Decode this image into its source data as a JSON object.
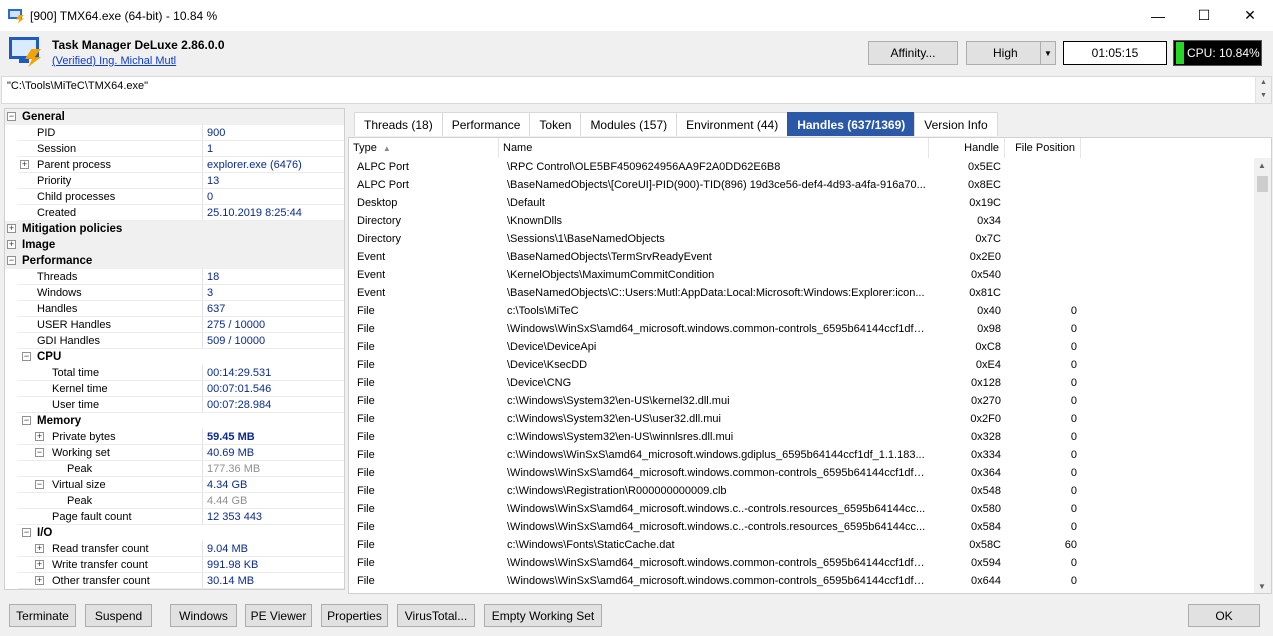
{
  "window": {
    "title": "[900] TMX64.exe (64-bit) - 10.84 %",
    "minimize": "—",
    "maximize": "☐",
    "close": "✕"
  },
  "header": {
    "app_name": "Task Manager DeLuxe 2.86.0.0",
    "publisher": "(Verified) Ing. Michal Mutl",
    "affinity_label": "Affinity...",
    "priority_value": "High",
    "priority_arrow": "▼",
    "elapsed_time": "01:05:15",
    "cpu_label": "CPU: 10.84%"
  },
  "path": "\"C:\\Tools\\MiTeC\\TMX64.exe\"",
  "path_scroll": {
    "up": "▲",
    "down": "▼"
  },
  "properties": {
    "general": {
      "label": "General",
      "exp": "−",
      "pid_label": "PID",
      "pid": "900",
      "session_label": "Session",
      "session": "1",
      "parent_exp": "+",
      "parent_label": "Parent process",
      "parent": "explorer.exe (6476)",
      "priority_label": "Priority",
      "priority": "13",
      "children_label": "Child processes",
      "children": "0",
      "created_label": "Created",
      "created": "25.10.2019 8:25:44"
    },
    "mitigation": {
      "label": "Mitigation policies",
      "exp": "+"
    },
    "image": {
      "label": "Image",
      "exp": "+"
    },
    "performance": {
      "label": "Performance",
      "exp": "−",
      "threads_label": "Threads",
      "threads": "18",
      "windows_label": "Windows",
      "windows": "3",
      "handles_label": "Handles",
      "handles": "637",
      "user_handles_label": "USER Handles",
      "user_handles": "275 / 10000",
      "gdi_handles_label": "GDI Handles",
      "gdi_handles": "509 / 10000",
      "cpu": {
        "label": "CPU",
        "exp": "−",
        "total_label": "Total time",
        "total": "00:14:29.531",
        "kernel_label": "Kernel time",
        "kernel": "00:07:01.546",
        "user_label": "User time",
        "user": "00:07:28.984"
      },
      "memory": {
        "label": "Memory",
        "exp": "−",
        "private_exp": "+",
        "private_label": "Private bytes",
        "private": "59.45 MB",
        "ws_exp": "−",
        "ws_label": "Working set",
        "ws": "40.69 MB",
        "ws_peak_label": "Peak",
        "ws_peak": "177.36 MB",
        "vs_exp": "−",
        "vs_label": "Virtual size",
        "vs": "4.34 GB",
        "vs_peak_label": "Peak",
        "vs_peak": "4.44 GB",
        "pf_label": "Page fault count",
        "pf": "12 353 443"
      },
      "io": {
        "label": "I/O",
        "exp": "−",
        "read_exp": "+",
        "read_label": "Read transfer count",
        "read": "9.04 MB",
        "write_exp": "+",
        "write_label": "Write transfer count",
        "write": "991.98 KB",
        "other_exp": "+",
        "other_label": "Other transfer count",
        "other": "30.14 MB"
      }
    }
  },
  "tabs": [
    {
      "label": "Threads (18)"
    },
    {
      "label": "Performance"
    },
    {
      "label": "Token"
    },
    {
      "label": "Modules (157)"
    },
    {
      "label": "Environment (44)"
    },
    {
      "label": "Handles (637/1369)"
    },
    {
      "label": "Version Info"
    }
  ],
  "handles_table": {
    "columns": {
      "type": "Type",
      "name": "Name",
      "handle": "Handle",
      "file_position": "File Position",
      "sort_glyph": "▲"
    },
    "rows": [
      {
        "type": "ALPC Port",
        "name": "\\RPC Control\\OLE5BF4509624956AA9F2A0DD62E6B8",
        "handle": "0x5EC",
        "fpos": ""
      },
      {
        "type": "ALPC Port",
        "name": "\\BaseNamedObjects\\[CoreUI]-PID(900)-TID(896) 19d3ce56-def4-4d93-a4fa-916a70...",
        "handle": "0x8EC",
        "fpos": ""
      },
      {
        "type": "Desktop",
        "name": "\\Default",
        "handle": "0x19C",
        "fpos": ""
      },
      {
        "type": "Directory",
        "name": "\\KnownDlls",
        "handle": "0x34",
        "fpos": ""
      },
      {
        "type": "Directory",
        "name": "\\Sessions\\1\\BaseNamedObjects",
        "handle": "0x7C",
        "fpos": ""
      },
      {
        "type": "Event",
        "name": "\\BaseNamedObjects\\TermSrvReadyEvent",
        "handle": "0x2E0",
        "fpos": ""
      },
      {
        "type": "Event",
        "name": "\\KernelObjects\\MaximumCommitCondition",
        "handle": "0x540",
        "fpos": ""
      },
      {
        "type": "Event",
        "name": "\\BaseNamedObjects\\C::Users:Mutl:AppData:Local:Microsoft:Windows:Explorer:icon...",
        "handle": "0x81C",
        "fpos": ""
      },
      {
        "type": "File",
        "name": "c:\\Tools\\MiTeC",
        "handle": "0x40",
        "fpos": "0"
      },
      {
        "type": "File",
        "name": "\\Windows\\WinSxS\\amd64_microsoft.windows.common-controls_6595b64144ccf1df_...",
        "handle": "0x98",
        "fpos": "0"
      },
      {
        "type": "File",
        "name": "\\Device\\DeviceApi",
        "handle": "0xC8",
        "fpos": "0"
      },
      {
        "type": "File",
        "name": "\\Device\\KsecDD",
        "handle": "0xE4",
        "fpos": "0"
      },
      {
        "type": "File",
        "name": "\\Device\\CNG",
        "handle": "0x128",
        "fpos": "0"
      },
      {
        "type": "File",
        "name": "c:\\Windows\\System32\\en-US\\kernel32.dll.mui",
        "handle": "0x270",
        "fpos": "0"
      },
      {
        "type": "File",
        "name": "c:\\Windows\\System32\\en-US\\user32.dll.mui",
        "handle": "0x2F0",
        "fpos": "0"
      },
      {
        "type": "File",
        "name": "c:\\Windows\\System32\\en-US\\winnlsres.dll.mui",
        "handle": "0x328",
        "fpos": "0"
      },
      {
        "type": "File",
        "name": "c:\\Windows\\WinSxS\\amd64_microsoft.windows.gdiplus_6595b64144ccf1df_1.1.183...",
        "handle": "0x334",
        "fpos": "0"
      },
      {
        "type": "File",
        "name": "\\Windows\\WinSxS\\amd64_microsoft.windows.common-controls_6595b64144ccf1df_...",
        "handle": "0x364",
        "fpos": "0"
      },
      {
        "type": "File",
        "name": "c:\\Windows\\Registration\\R000000000009.clb",
        "handle": "0x548",
        "fpos": "0"
      },
      {
        "type": "File",
        "name": "\\Windows\\WinSxS\\amd64_microsoft.windows.c..-controls.resources_6595b64144cc...",
        "handle": "0x580",
        "fpos": "0"
      },
      {
        "type": "File",
        "name": "\\Windows\\WinSxS\\amd64_microsoft.windows.c..-controls.resources_6595b64144cc...",
        "handle": "0x584",
        "fpos": "0"
      },
      {
        "type": "File",
        "name": "c:\\Windows\\Fonts\\StaticCache.dat",
        "handle": "0x58C",
        "fpos": "60"
      },
      {
        "type": "File",
        "name": "\\Windows\\WinSxS\\amd64_microsoft.windows.common-controls_6595b64144ccf1df_...",
        "handle": "0x594",
        "fpos": "0"
      },
      {
        "type": "File",
        "name": "\\Windows\\WinSxS\\amd64_microsoft.windows.common-controls_6595b64144ccf1df_...",
        "handle": "0x644",
        "fpos": "0"
      }
    ],
    "scroll": {
      "up": "▲",
      "down": "▼"
    }
  },
  "buttons": {
    "terminate": "Terminate",
    "suspend": "Suspend",
    "windows": "Windows",
    "pe_viewer": "PE Viewer",
    "properties": "Properties",
    "virustotal": "VirusTotal...",
    "empty_ws": "Empty Working Set",
    "ok": "OK"
  }
}
